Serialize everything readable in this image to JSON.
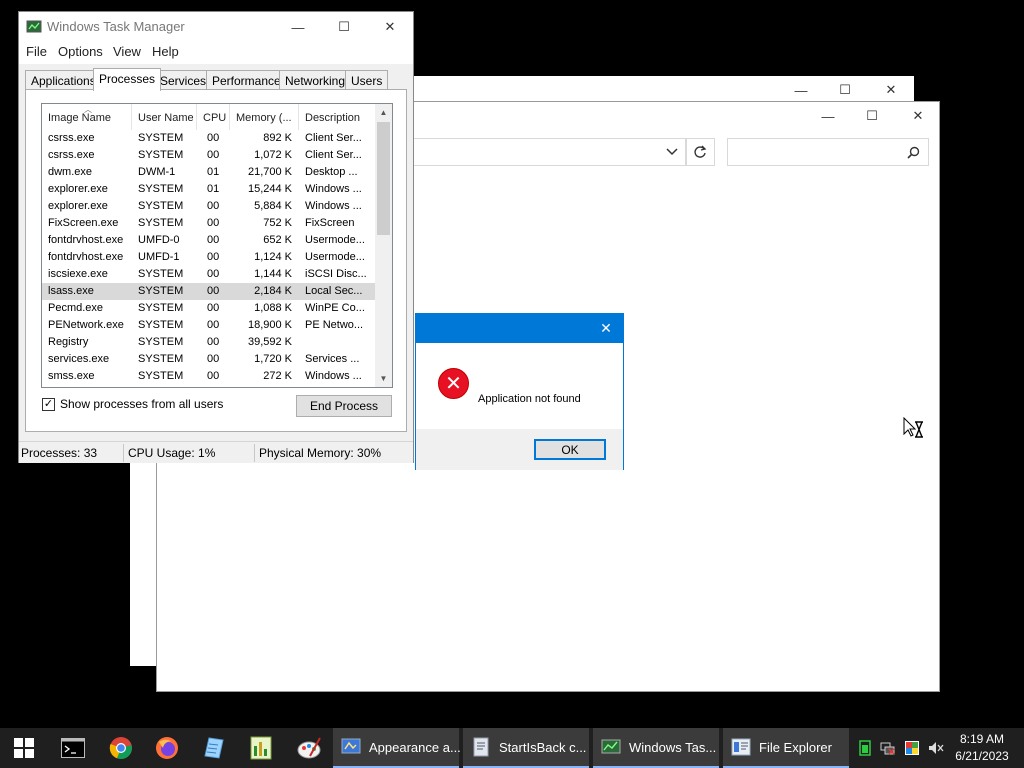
{
  "task_manager": {
    "title": "Windows Task Manager",
    "menu": [
      "File",
      "Options",
      "View",
      "Help"
    ],
    "tabs": [
      "Applications",
      "Processes",
      "Services",
      "Performance",
      "Networking",
      "Users"
    ],
    "active_tab": "Processes",
    "columns": [
      "Image Name",
      "User Name",
      "CPU",
      "Memory (...",
      "Description"
    ],
    "processes": [
      {
        "image": "csrss.exe",
        "user": "SYSTEM",
        "cpu": "00",
        "mem": "892 K",
        "desc": "Client Ser..."
      },
      {
        "image": "csrss.exe",
        "user": "SYSTEM",
        "cpu": "00",
        "mem": "1,072 K",
        "desc": "Client Ser..."
      },
      {
        "image": "dwm.exe",
        "user": "DWM-1",
        "cpu": "01",
        "mem": "21,700 K",
        "desc": "Desktop ..."
      },
      {
        "image": "explorer.exe",
        "user": "SYSTEM",
        "cpu": "01",
        "mem": "15,244 K",
        "desc": "Windows ..."
      },
      {
        "image": "explorer.exe",
        "user": "SYSTEM",
        "cpu": "00",
        "mem": "5,884 K",
        "desc": "Windows ..."
      },
      {
        "image": "FixScreen.exe",
        "user": "SYSTEM",
        "cpu": "00",
        "mem": "752 K",
        "desc": "FixScreen"
      },
      {
        "image": "fontdrvhost.exe",
        "user": "UMFD-0",
        "cpu": "00",
        "mem": "652 K",
        "desc": "Usermode..."
      },
      {
        "image": "fontdrvhost.exe",
        "user": "UMFD-1",
        "cpu": "00",
        "mem": "1,124 K",
        "desc": "Usermode..."
      },
      {
        "image": "iscsiexe.exe",
        "user": "SYSTEM",
        "cpu": "00",
        "mem": "1,144 K",
        "desc": "iSCSI Disc..."
      },
      {
        "image": "lsass.exe",
        "user": "SYSTEM",
        "cpu": "00",
        "mem": "2,184 K",
        "desc": "Local Sec..."
      },
      {
        "image": "Pecmd.exe",
        "user": "SYSTEM",
        "cpu": "00",
        "mem": "1,088 K",
        "desc": "WinPE Co..."
      },
      {
        "image": "PENetwork.exe",
        "user": "SYSTEM",
        "cpu": "00",
        "mem": "18,900 K",
        "desc": "PE Netwo..."
      },
      {
        "image": "Registry",
        "user": "SYSTEM",
        "cpu": "00",
        "mem": "39,592 K",
        "desc": ""
      },
      {
        "image": "services.exe",
        "user": "SYSTEM",
        "cpu": "00",
        "mem": "1,720 K",
        "desc": "Services ..."
      },
      {
        "image": "smss.exe",
        "user": "SYSTEM",
        "cpu": "00",
        "mem": "272 K",
        "desc": "Windows ..."
      }
    ],
    "selected_row": 9,
    "show_all_label": "Show processes from all users",
    "show_all_checked": true,
    "end_process_label": "End Process",
    "status": {
      "processes": "Processes: 33",
      "cpu": "CPU Usage: 1%",
      "memory": "Physical Memory: 30%"
    }
  },
  "dialog": {
    "message": "Application not found",
    "ok_label": "OK"
  },
  "taskbar": {
    "buttons": [
      {
        "label": "Appearance a..."
      },
      {
        "label": "StartIsBack c..."
      },
      {
        "label": "Windows Tas..."
      },
      {
        "label": "File Explorer"
      }
    ],
    "time": "8:19 AM",
    "date": "6/21/2023"
  }
}
